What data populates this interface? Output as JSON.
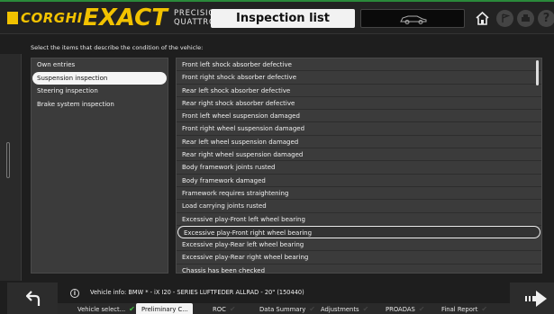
{
  "header": {
    "brand": "CORGHI",
    "product": "EXACT",
    "product_sub_line1": "PRECISION",
    "product_sub_line2": "QUATTRO",
    "title": "Inspection list"
  },
  "instruction": "Select the items that describe the condition of the vehicle:",
  "categories": [
    {
      "label": "Own entries",
      "active": false
    },
    {
      "label": "Suspension inspection",
      "active": true
    },
    {
      "label": "Steering inspection",
      "active": false
    },
    {
      "label": "Brake system inspection",
      "active": false
    }
  ],
  "items": [
    {
      "label": "Front left shock absorber defective",
      "selected": false
    },
    {
      "label": "Front right shock absorber defective",
      "selected": false
    },
    {
      "label": "Rear left shock absorber defective",
      "selected": false
    },
    {
      "label": "Rear right shock absorber defective",
      "selected": false
    },
    {
      "label": "Front left wheel suspension damaged",
      "selected": false
    },
    {
      "label": "Front right wheel suspension damaged",
      "selected": false
    },
    {
      "label": "Rear left wheel suspension damaged",
      "selected": false
    },
    {
      "label": "Rear right wheel suspension damaged",
      "selected": false
    },
    {
      "label": "Body framework joints rusted",
      "selected": false
    },
    {
      "label": "Body framework damaged",
      "selected": false
    },
    {
      "label": "Framework requires straightening",
      "selected": false
    },
    {
      "label": "Load carrying joints rusted",
      "selected": false
    },
    {
      "label": "Excessive play-Front left wheel bearing",
      "selected": false
    },
    {
      "label": "Excessive play-Front right wheel bearing",
      "selected": true
    },
    {
      "label": "Excessive play-Rear left wheel bearing",
      "selected": false
    },
    {
      "label": "Excessive play-Rear right wheel bearing",
      "selected": false
    },
    {
      "label": "Chassis has been checked",
      "selected": false
    }
  ],
  "vehicle_info": "Vehicle info: BMW * - iX I20 - SERIES LUFTFEDER ALLRAD - 20\" (150440)",
  "steps": [
    {
      "label": "Vehicle select...",
      "state": "done"
    },
    {
      "label": "Preliminary C...",
      "state": "current"
    },
    {
      "label": "ROC",
      "state": "todo"
    },
    {
      "label": "Data Summary",
      "state": "todo"
    },
    {
      "label": "Adjustments",
      "state": "todo"
    },
    {
      "label": "PROADAS",
      "state": "todo"
    },
    {
      "label": "Final Report",
      "state": "todo"
    }
  ],
  "help_glyph": "?",
  "info_glyph": "i",
  "colors": {
    "brand_yellow": "#f2c200",
    "accent_green": "#2a8a3a",
    "check_green": "#3fbf3f"
  }
}
